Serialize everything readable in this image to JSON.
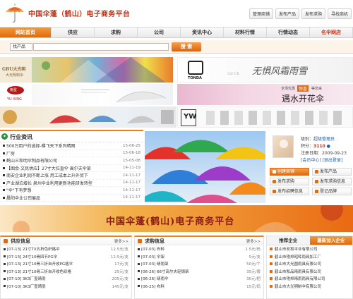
{
  "header": {
    "site_title": "中国伞蓬（鹤山）电子商务平台",
    "top_links": [
      "管理商铺",
      "发布产品",
      "发布求购",
      "寻找商机"
    ]
  },
  "nav": {
    "items": [
      "网站首页",
      "供应",
      "求购",
      "公司",
      "资讯中心",
      "材料行情",
      "行情动态",
      "名伞网店"
    ]
  },
  "search": {
    "category_value": "找产品",
    "placeholder": "",
    "button_label": "搜 索"
  },
  "banners": {
    "gbu": "GBU大光明",
    "gbu_sub": "大光明制伞",
    "yuxing_brand": "雨星",
    "yuxing_en": "YU XING",
    "tonda": "TONDA",
    "tonda_slogan": "无惧风霜雨雪",
    "tonda_num": "33/ CE",
    "yushuikaihua": "遇水开花伞",
    "yushui_small": "全场优惠",
    "yushui_badge": "惊喜",
    "yushui_more": "等您来",
    "yw": "YW"
  },
  "news": {
    "title": "行业资讯",
    "items": [
      {
        "title": "500万用户的选择-蝶飞天下系列晴雨",
        "date": "15-06-25"
      },
      {
        "title": "厂房",
        "date": "15-06-18"
      },
      {
        "title": "鹤山三和明伞制品有限公司",
        "date": "15-05-08"
      },
      {
        "title": "【图会-文民供应】27寸大拉直伞 高尔夫伞架",
        "date": "14-11-19"
      },
      {
        "title": "南安企业利润不断上涨 用工成本上升外贸下",
        "date": "14-11-17"
      },
      {
        "title": "产业湖泊增长 泉州伞业利用更新功能研发转型",
        "date": "14-11-17"
      },
      {
        "title": "\"伞\"下有梦想",
        "date": "14-11-17"
      },
      {
        "title": "晨阳伞业公司展品",
        "date": "14-11-17"
      }
    ]
  },
  "user": {
    "id_label": "级别：",
    "id_value": "超级管理员",
    "points_label": "积分：",
    "points_value": "3110",
    "reg_label": "注册日期：",
    "reg_value": "2009-09-23",
    "status": "[会员中心] [退出登录]",
    "actions": [
      "创建商铺",
      "发布产品",
      "发布求购",
      "发布求购信息",
      "发布招聘信息",
      "登记品牌"
    ]
  },
  "big_banner": {
    "title": "中国伞蓬(鹤山)电子商务平台"
  },
  "supply": {
    "title": "供应信息",
    "more": "更多>>",
    "items": [
      {
        "title": "[07-13] 21寸TX五折色织格伞",
        "value": "12.5元/支"
      },
      {
        "title": "[07-13] 24寸10骨四节PG伞",
        "value": "12.5元/支"
      },
      {
        "title": "[07-13] 21寸10骨三折自开收PG格伞",
        "value": "17元/支"
      },
      {
        "title": "[07-13] 21寸10骨三折自开收色织格",
        "value": "25元/支"
      },
      {
        "title": "[07-10] 3K3厂壹晴雨",
        "value": "205元/支"
      },
      {
        "title": "[07-10] 3K3厂壹晴雨",
        "value": "145元/支"
      }
    ]
  },
  "buy": {
    "title": "求购信息",
    "more": "更多>>",
    "items": [
      {
        "title": "[07-03] 布料",
        "value": "1.5元/码"
      },
      {
        "title": "[07-03] 伞架",
        "value": "5元/支"
      },
      {
        "title": "[07-03] 晴雨架",
        "value": "50元/个"
      },
      {
        "title": "[06-26] 66寸高尔夫轻钢架",
        "value": "35元/套"
      },
      {
        "title": "[06-26] 晴雨伞",
        "value": "30元/把"
      },
      {
        "title": "[06-25] 布料",
        "value": "15元/码"
      }
    ]
  },
  "enterprises": {
    "tabs": [
      "推荐企业",
      "最新加入企业"
    ],
    "items": [
      "鹤山市宏和伞业有限公司",
      "鹤山市艳邦昭晖雨具加工厂",
      "鹤山市大光圆雨具有限公司",
      "鹤山市和品晴雨具有限公司",
      "鹤山市艳邦晴雨雨具有限公司",
      "鹤山市大光明制伞有限公司"
    ]
  }
}
